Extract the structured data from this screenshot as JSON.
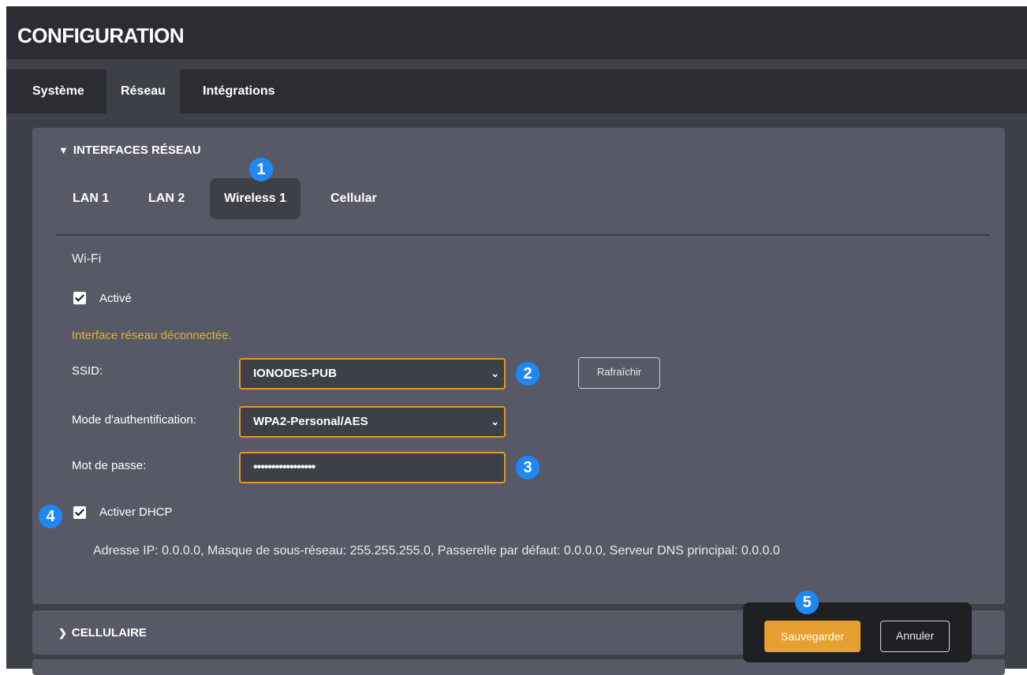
{
  "header": {
    "title": "CONFIGURATION"
  },
  "tabs": [
    {
      "label": "Système"
    },
    {
      "label": "Réseau"
    },
    {
      "label": "Intégrations"
    }
  ],
  "network_panel": {
    "title": "INTERFACES RÉSEAU",
    "subtabs": [
      {
        "label": "LAN 1"
      },
      {
        "label": "LAN 2"
      },
      {
        "label": "Wireless 1"
      },
      {
        "label": "Cellular"
      }
    ],
    "section_title": "Wi-Fi",
    "enabled_label": "Activé",
    "status_warning": "Interface réseau déconnectée.",
    "ssid_label": "SSID:",
    "ssid_value": "IONODES-PUB",
    "refresh_label": "Rafraîchir",
    "auth_label": "Mode d'authentification:",
    "auth_value": "WPA2-Personal/AES",
    "password_label": "Mot de passe:",
    "password_value": "•••••••••••••••••",
    "dhcp_label": "Activer DHCP",
    "ip_info": "Adresse IP: 0.0.0.0, Masque de sous-réseau: 255.255.255.0, Passerelle par défaut: 0.0.0.0, Serveur DNS principal: 0.0.0.0"
  },
  "cellular_panel": {
    "title": "CELLULAIRE"
  },
  "actions": {
    "save_label": "Sauvegarder",
    "cancel_label": "Annuler"
  },
  "callouts": [
    "1",
    "2",
    "3",
    "4",
    "5"
  ],
  "colors": {
    "accent": "#e6a032",
    "callout": "#1e88f5",
    "warning": "#e0b23a"
  }
}
